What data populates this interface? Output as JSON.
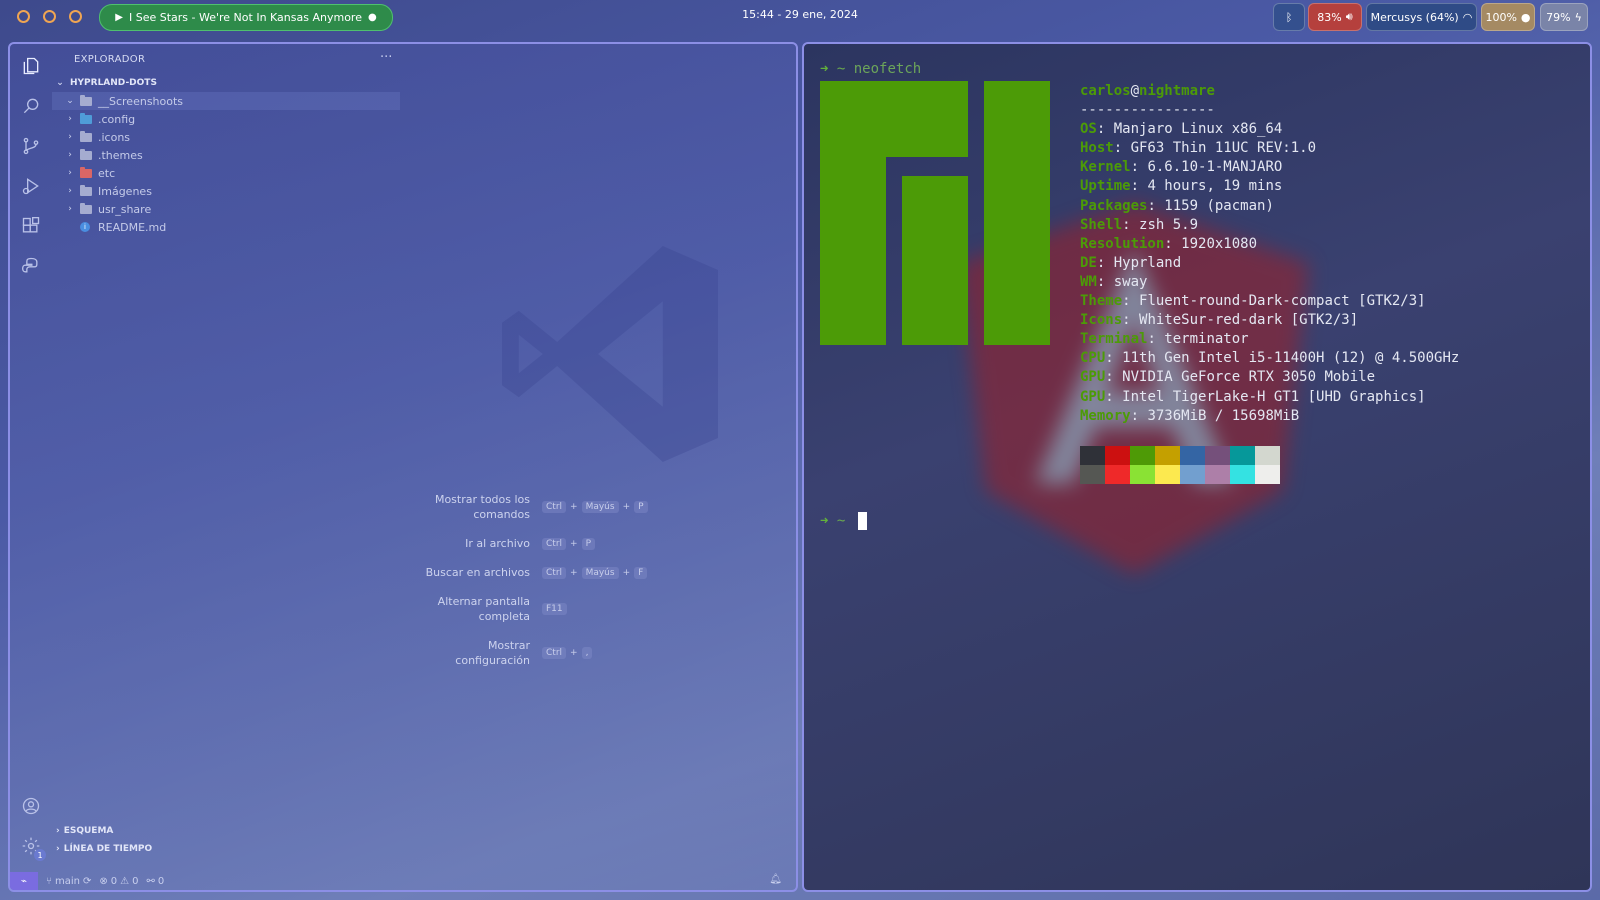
{
  "topbar": {
    "workspaces": [
      {
        "name": "workspace-1"
      },
      {
        "name": "workspace-2"
      },
      {
        "name": "workspace-3"
      }
    ],
    "media_title": "I See Stars - We're Not In Kansas Anymore",
    "clock": "15:44 - 29 ene, 2024",
    "volume": "83%",
    "network": "Mercusys (64%)",
    "brightness": "100%",
    "battery": "79%",
    "colors": {
      "media_bg": "#2e8b4a",
      "volume_bg": "#b5403d",
      "workspace_ring": "#f0a552"
    }
  },
  "vscode": {
    "explorer_title": "EXPLORADOR",
    "root_folder": "HYPRLAND-DOTS",
    "tree": [
      {
        "label": "__Screenshoots",
        "type": "folder-open",
        "color": "grey"
      },
      {
        "label": ".config",
        "type": "folder",
        "color": "blue"
      },
      {
        "label": ".icons",
        "type": "folder",
        "color": "grey"
      },
      {
        "label": ".themes",
        "type": "folder",
        "color": "grey"
      },
      {
        "label": "etc",
        "type": "folder",
        "color": "red"
      },
      {
        "label": "Imágenes",
        "type": "folder",
        "color": "grey"
      },
      {
        "label": "usr_share",
        "type": "folder",
        "color": "grey"
      },
      {
        "label": "README.md",
        "type": "file",
        "color": "blue"
      }
    ],
    "sections": [
      "ESQUEMA",
      "LÍNEA DE TIEMPO"
    ],
    "hints": [
      {
        "label": "Mostrar todos los comandos",
        "keys": [
          "Ctrl",
          "Mayús",
          "P"
        ]
      },
      {
        "label": "Ir al archivo",
        "keys": [
          "Ctrl",
          "P"
        ]
      },
      {
        "label": "Buscar en archivos",
        "keys": [
          "Ctrl",
          "Mayús",
          "F"
        ]
      },
      {
        "label": "Alternar pantalla completa",
        "keys": [
          "F11"
        ]
      },
      {
        "label": "Mostrar configuración",
        "keys": [
          "Ctrl",
          ","
        ]
      }
    ],
    "status": {
      "branch": "main",
      "errors": "0",
      "warnings": "0",
      "ports": "0"
    },
    "accounts_badge": "1"
  },
  "terminal": {
    "prompt_symbol": "➜",
    "cwd": "~",
    "command": "neofetch",
    "user": "carlos",
    "host": "nightmare",
    "separator": "----------------",
    "info": [
      {
        "key": "OS",
        "value": "Manjaro Linux x86_64"
      },
      {
        "key": "Host",
        "value": "GF63 Thin 11UC REV:1.0"
      },
      {
        "key": "Kernel",
        "value": "6.6.10-1-MANJARO"
      },
      {
        "key": "Uptime",
        "value": "4 hours, 19 mins"
      },
      {
        "key": "Packages",
        "value": "1159 (pacman)"
      },
      {
        "key": "Shell",
        "value": "zsh 5.9"
      },
      {
        "key": "Resolution",
        "value": "1920x1080"
      },
      {
        "key": "DE",
        "value": "Hyprland"
      },
      {
        "key": "WM",
        "value": "sway"
      },
      {
        "key": "Theme",
        "value": "Fluent-round-Dark-compact [GTK2/3]"
      },
      {
        "key": "Icons",
        "value": "WhiteSur-red-dark [GTK2/3]"
      },
      {
        "key": "Terminal",
        "value": "terminator"
      },
      {
        "key": "CPU",
        "value": "11th Gen Intel i5-11400H (12) @ 4.500GHz"
      },
      {
        "key": "GPU",
        "value": "NVIDIA GeForce RTX 3050 Mobile"
      },
      {
        "key": "GPU",
        "value": "Intel TigerLake-H GT1 [UHD Graphics]"
      },
      {
        "key": "Memory",
        "value": "3736MiB / 15698MiB"
      }
    ],
    "palette_top": [
      "#2f3138",
      "#cc1010",
      "#4e9a06",
      "#c4a000",
      "#3465a4",
      "#75507b",
      "#06989a",
      "#d3d7cf"
    ],
    "palette_bottom": [
      "#555753",
      "#ef2929",
      "#8ae234",
      "#fce94f",
      "#729fcf",
      "#ad7fa8",
      "#34e2e2",
      "#eeeeec"
    ],
    "logo_color": "#4c9b07"
  }
}
